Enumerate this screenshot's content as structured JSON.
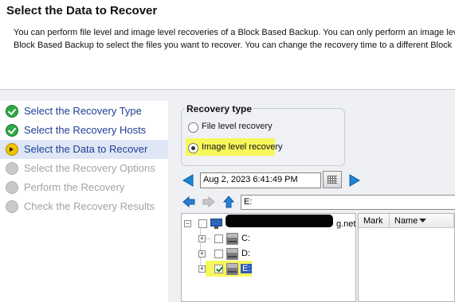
{
  "header": {
    "title": "Select the Data to Recover",
    "desc_line1": "You can perform file level and image level recoveries of a Block Based Backup.  You can only perform an image lev",
    "desc_line2": "Block Based Backup to select the files you want to recover.  You can change the recovery time to a different Block"
  },
  "steps": [
    {
      "label": "Select the Recovery Type",
      "status": "done"
    },
    {
      "label": "Select the Recovery Hosts",
      "status": "done"
    },
    {
      "label": "Select the Data to Recover",
      "status": "current"
    },
    {
      "label": "Select the Recovery Options",
      "status": "pending"
    },
    {
      "label": "Perform the Recovery",
      "status": "pending"
    },
    {
      "label": "Check the Recovery Results",
      "status": "pending"
    }
  ],
  "recovery_type": {
    "title": "Recovery type",
    "options": [
      {
        "label": "File level recovery",
        "selected": false
      },
      {
        "label": "Image level recovery",
        "selected": true
      }
    ]
  },
  "time": {
    "value": "Aug 2, 2023 6:41:49 PM"
  },
  "path": {
    "value": "E:"
  },
  "tree": {
    "root_label_suffix": "g.net",
    "drives": [
      {
        "label": "C:",
        "checked": false
      },
      {
        "label": "D:",
        "checked": false
      },
      {
        "label": "E:",
        "checked": true
      }
    ]
  },
  "list": {
    "columns": [
      "Mark",
      "Name"
    ]
  },
  "colors": {
    "highlight": "#f6f75a",
    "step_done": "#2fa845",
    "step_link": "#1f3f95",
    "step_disabled": "#a3a3a3"
  }
}
